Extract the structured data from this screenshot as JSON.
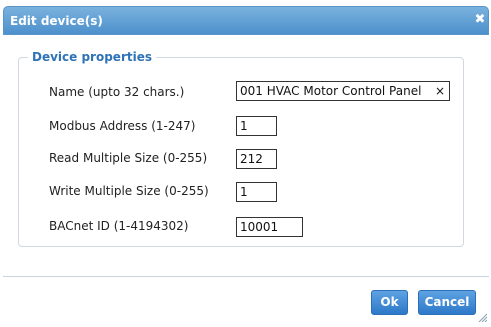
{
  "dialog": {
    "title": "Edit device(s)",
    "close_glyph": "✖",
    "ok_label": "Ok",
    "cancel_label": "Cancel"
  },
  "properties": {
    "legend": "Device properties",
    "fields": [
      {
        "label": "Name (upto 32 chars.)",
        "value": "001 HVAC Motor Control Panel"
      },
      {
        "label": "Modbus Address (1-247)",
        "value": "1"
      },
      {
        "label": "Read Multiple Size (0-255)",
        "value": "212"
      },
      {
        "label": "Write Multiple Size (0-255)",
        "value": "1"
      },
      {
        "label": "BACnet ID (1-4194302)",
        "value": "10001"
      }
    ],
    "clear_glyph": "×"
  },
  "icons": {
    "close": "close-icon",
    "clear": "clear-icon",
    "resize": "resize-grip-icon"
  },
  "colors": {
    "titlebar": "#4d90cc",
    "legend": "#2f73b7",
    "button": "#2d78c8"
  }
}
